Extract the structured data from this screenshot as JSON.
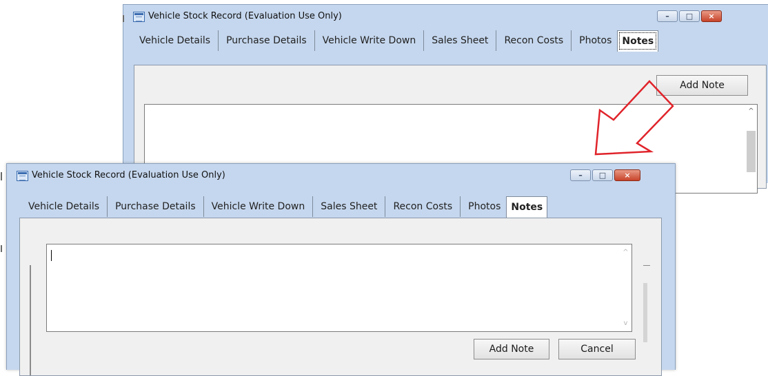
{
  "back_window": {
    "title": "Vehicle Stock Record  (Evaluation Use Only)",
    "tabs": [
      "Vehicle Details",
      "Purchase Details",
      "Vehicle Write Down",
      "Sales Sheet",
      "Recon Costs",
      "Photos",
      "Notes"
    ],
    "active_tab": "Notes",
    "add_note_label": "Add Note",
    "scroll_up_glyph": "^"
  },
  "front_window": {
    "title": "Vehicle Stock Record  (Evaluation Use Only)",
    "tabs": [
      "Vehicle Details",
      "Purchase Details",
      "Vehicle Write Down",
      "Sales Sheet",
      "Recon Costs",
      "Photos",
      "Notes"
    ],
    "active_tab": "Notes",
    "note_text": "",
    "add_note_label": "Add Note",
    "cancel_label": "Cancel",
    "scroll_up_glyph": "^",
    "scroll_down_glyph": "v"
  },
  "window_buttons": {
    "minimize": "–",
    "maximize": "□",
    "close": "×"
  },
  "colors": {
    "window_frame": "#c5d7ee",
    "panel": "#f0f0f0",
    "arrow": "#e0232a"
  },
  "icons": [
    "app-window-icon",
    "minimize-icon",
    "maximize-icon",
    "close-icon",
    "red-arrow"
  ]
}
